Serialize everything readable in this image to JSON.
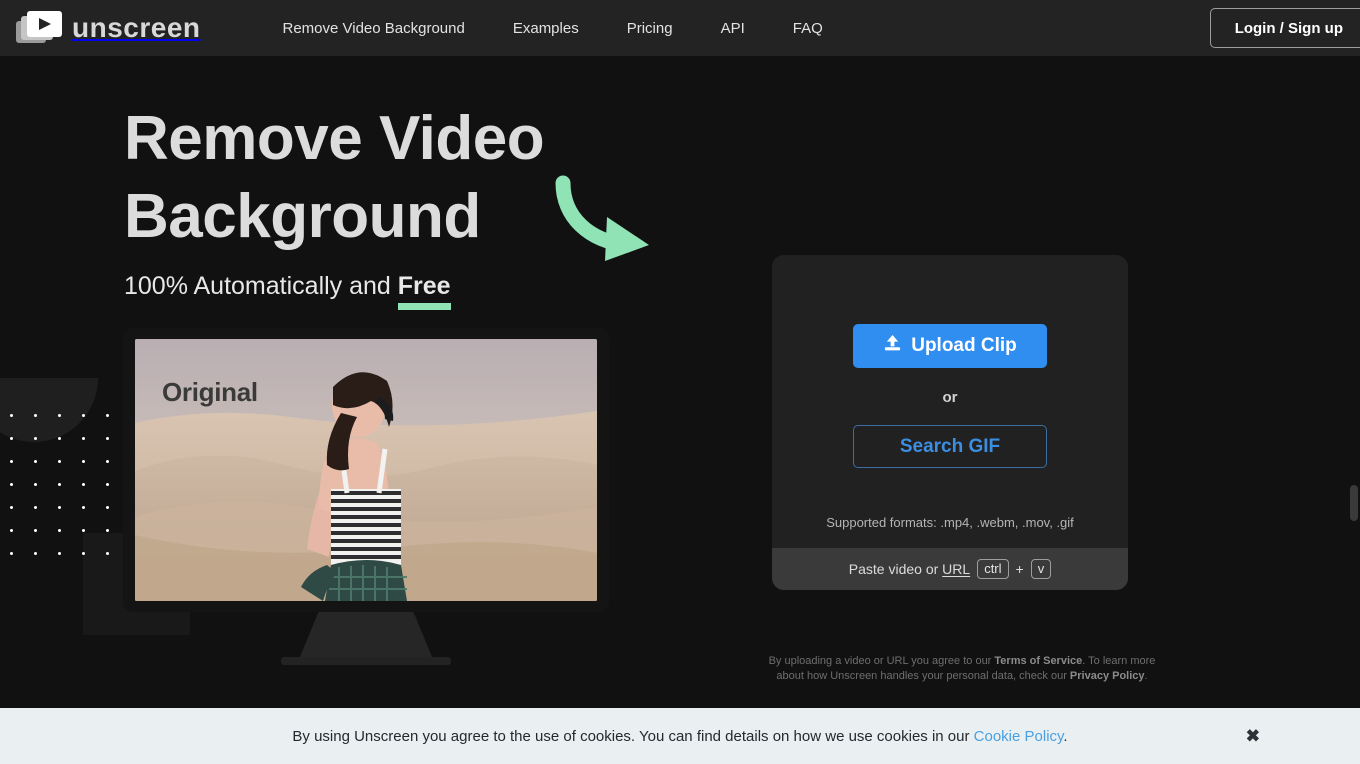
{
  "header": {
    "logo_text": "unscreen",
    "logo_icon": "video-stack-play-icon",
    "nav": [
      {
        "label": "Remove Video Background"
      },
      {
        "label": "Examples"
      },
      {
        "label": "Pricing"
      },
      {
        "label": "API"
      },
      {
        "label": "FAQ"
      }
    ],
    "login_label": "Login / Sign up"
  },
  "hero": {
    "title_line1": "Remove Video",
    "title_line2": "Background",
    "subtitle_prefix": "100% Automatically and ",
    "subtitle_highlight": "Free",
    "arrow_icon": "curved-arrow-down-right-icon",
    "accent_color": "#8fe3b5"
  },
  "preview": {
    "label": "Original",
    "alt": "woman walking in desert dunes"
  },
  "upload_card": {
    "upload_label": "Upload Clip",
    "upload_icon": "upload-icon",
    "upload_color": "#2f8eef",
    "or_label": "or",
    "search_gif_label": "Search GIF",
    "search_gif_color": "#3c8ee0",
    "formats": "Supported formats: .mp4, .webm, .mov, .gif",
    "paste_prefix": "Paste video or ",
    "paste_link": "URL",
    "key_ctrl": "ctrl",
    "key_plus": "+",
    "key_v": "v"
  },
  "legal": {
    "part1": "By uploading a video or URL you agree to our ",
    "terms": "Terms of Service",
    "part2": ". To learn more about how Unscreen handles your personal data, check our ",
    "privacy": "Privacy Policy",
    "part3": "."
  },
  "cookie": {
    "text_before": "By using Unscreen you agree to the use of cookies. You can find details on how we use cookies in our ",
    "link": "Cookie Policy",
    "text_after": ".",
    "close_icon": "close-icon",
    "close_glyph": "✖"
  }
}
